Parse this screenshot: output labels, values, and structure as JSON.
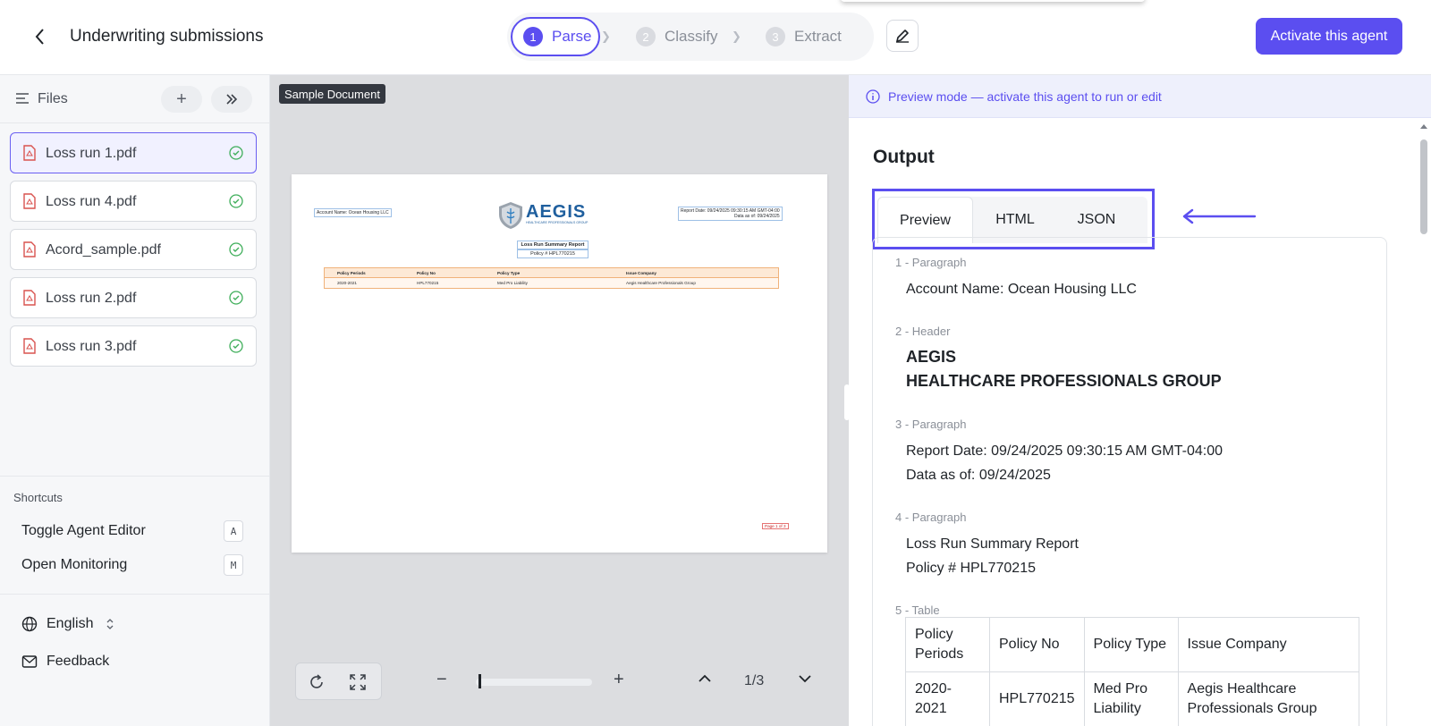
{
  "header": {
    "title": "Underwriting submissions",
    "steps": [
      {
        "num": "1",
        "label": "Parse"
      },
      {
        "num": "2",
        "label": "Classify"
      },
      {
        "num": "3",
        "label": "Extract"
      }
    ],
    "activate_label": "Activate this agent"
  },
  "sidebar": {
    "files_label": "Files",
    "files": [
      {
        "name": "Loss run 1.pdf"
      },
      {
        "name": "Loss run 4.pdf"
      },
      {
        "name": "Acord_sample.pdf"
      },
      {
        "name": "Loss run 2.pdf"
      },
      {
        "name": "Loss run 3.pdf"
      }
    ],
    "shortcuts_title": "Shortcuts",
    "shortcuts": [
      {
        "label": "Toggle Agent Editor",
        "key": "A"
      },
      {
        "label": "Open Monitoring",
        "key": "M"
      }
    ],
    "language": "English",
    "feedback": "Feedback"
  },
  "viewer": {
    "badge": "Sample Document",
    "page_count": "1/3",
    "zoom_fraction": 0.02,
    "doc": {
      "account": "Account Name: Ocean Housing LLC",
      "logo_text": "AEGIS",
      "logo_sub": "HEALTHCARE PROFESSIONALS GROUP",
      "report_date": "Report Date: 09/24/2025 09:30:15 AM GMT-04:00",
      "data_as_of": "Data as of: 09/24/2025",
      "title": "Loss Run Summary Report",
      "policy": "Policy # HPL770215",
      "table_head": [
        "Policy Periods",
        "Policy No",
        "Policy Type",
        "Issue Company"
      ],
      "table_row": [
        "2020-2021",
        "HPL770215",
        "Med Pro Liability",
        "Aegis Healthcare Professionals Group"
      ],
      "footer": "Page 1 of 3"
    }
  },
  "output": {
    "banner": "Preview mode — activate this agent to run or edit",
    "title": "Output",
    "tabs": [
      "Preview",
      "HTML",
      "JSON"
    ],
    "sections": [
      {
        "label": "1 - Paragraph",
        "lines": [
          "Account Name: Ocean Housing LLC"
        ]
      },
      {
        "label": "2 - Header",
        "lines": [
          "AEGIS",
          "HEALTHCARE PROFESSIONALS GROUP"
        ]
      },
      {
        "label": "3 - Paragraph",
        "lines": [
          "Report Date: 09/24/2025 09:30:15 AM GMT-04:00",
          "Data as of: 09/24/2025"
        ]
      },
      {
        "label": "4 - Paragraph",
        "lines": [
          "Loss Run Summary Report",
          "Policy # HPL770215"
        ]
      },
      {
        "label": "5 - Table",
        "lines": []
      }
    ],
    "table": {
      "head": [
        "Policy Periods",
        "Policy No",
        "Policy Type",
        "Issue Company"
      ],
      "row": [
        "2020-2021",
        "HPL770215",
        "Med Pro Liability",
        "Aegis Healthcare Professionals Group"
      ]
    },
    "colors": {
      "accent": "#5b4ef0"
    }
  }
}
